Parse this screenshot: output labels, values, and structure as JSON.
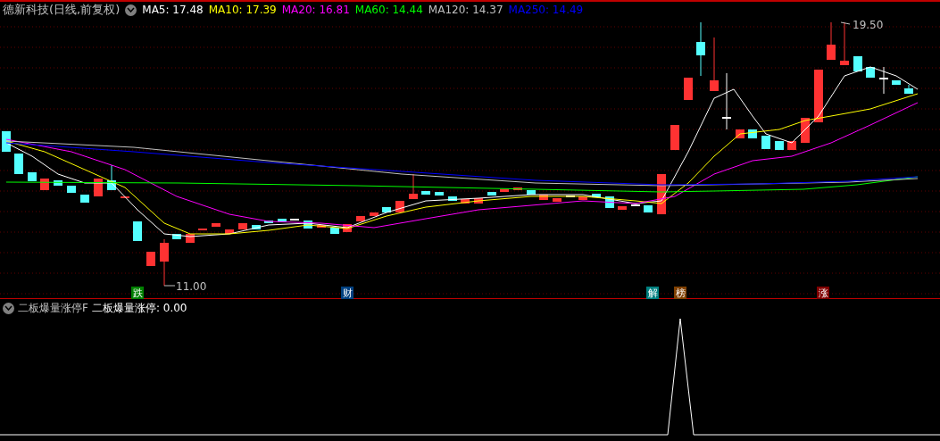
{
  "main_chart": {
    "title": "德新科技(日线,前复权)",
    "indicators": [
      {
        "label": "MA5: 17.48",
        "color": "#ffffff"
      },
      {
        "label": "MA10: 17.39",
        "color": "#ffff00"
      },
      {
        "label": "MA20: 16.81",
        "color": "#ff00ff"
      },
      {
        "label": "MA60: 14.44",
        "color": "#00ff00"
      },
      {
        "label": "MA120: 14.37",
        "color": "#c0c0c0"
      },
      {
        "label": "MA250: 14.49",
        "color": "#0000ff"
      }
    ],
    "high_label": "19.50",
    "low_label": "11.00",
    "markers": [
      {
        "text": "跌",
        "color": "#008000"
      },
      {
        "text": "财",
        "color": "#004080"
      },
      {
        "text": "解",
        "color": "#008080"
      },
      {
        "text": "榜",
        "color": "#804000"
      },
      {
        "text": "涨",
        "color": "#800000"
      }
    ]
  },
  "sub_chart": {
    "title": "二板爆量涨停F",
    "reading": "二板爆量涨停: 0.00"
  }
}
